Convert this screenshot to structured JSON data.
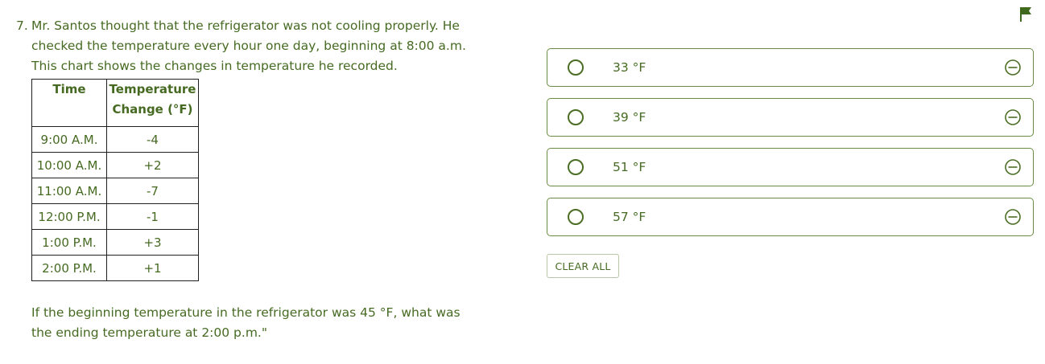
{
  "question": {
    "number": "7.",
    "intro": "Mr. Santos thought that the refrigerator was not cooling properly. He checked the temperature every hour one day, beginning at 8:00 a.m. This chart shows the changes in temperature he recorded.",
    "table": {
      "headers": [
        "Time",
        "Temperature Change (°F)"
      ],
      "rows": [
        [
          "9:00 A.M.",
          "-4"
        ],
        [
          "10:00 A.M.",
          "+2"
        ],
        [
          "11:00 A.M.",
          "-7"
        ],
        [
          "12:00 P.M.",
          "-1"
        ],
        [
          "1:00 P.M.",
          "+3"
        ],
        [
          "2:00 P.M.",
          "+1"
        ]
      ]
    },
    "followup": "If the beginning temperature in the refrigerator was 45 °F, what was the ending temperature at 2:00 p.m.\""
  },
  "choices": [
    {
      "label": "33 °F"
    },
    {
      "label": "39 °F"
    },
    {
      "label": "51 °F"
    },
    {
      "label": "57 °F"
    }
  ],
  "clear_all_label": "CLEAR ALL",
  "icons": {
    "flag": "flag-icon",
    "radio": "radio-circle-icon",
    "eliminate": "minus-circle-icon"
  },
  "colors": {
    "accent": "#466a22",
    "border": "#6a8b44"
  }
}
